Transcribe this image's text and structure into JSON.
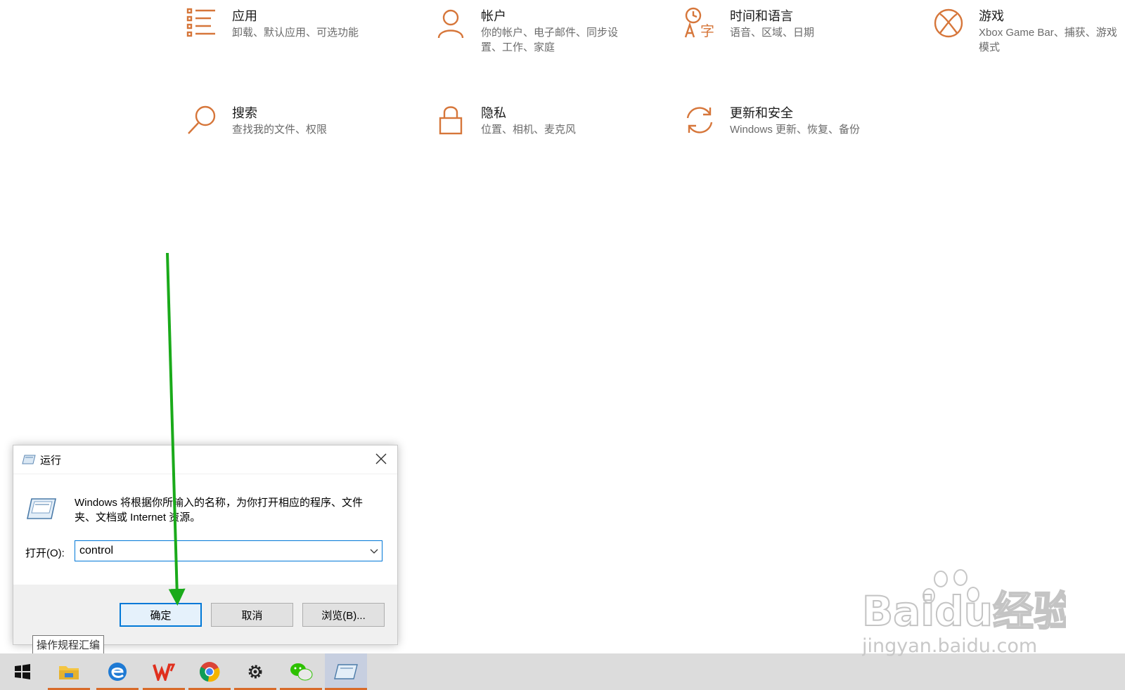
{
  "settings_tiles": [
    {
      "icon": "apps-list-icon",
      "title": "应用",
      "desc": "卸载、默认应用、可选功能"
    },
    {
      "icon": "account-person-icon",
      "title": "帐户",
      "desc": "你的帐户、电子邮件、同步设置、工作、家庭"
    },
    {
      "icon": "time-language-icon",
      "title": "时间和语言",
      "desc": "语音、区域、日期"
    },
    {
      "icon": "xbox-icon",
      "title": "游戏",
      "desc": "Xbox Game Bar、捕获、游戏模式"
    },
    {
      "icon": "search-magnifier-icon",
      "title": "搜索",
      "desc": "查找我的文件、权限"
    },
    {
      "icon": "privacy-lock-icon",
      "title": "隐私",
      "desc": "位置、相机、麦克风"
    },
    {
      "icon": "update-refresh-icon",
      "title": "更新和安全",
      "desc": "Windows 更新、恢复、备份"
    }
  ],
  "run_dialog": {
    "title": "运行",
    "message": "Windows 将根据你所输入的名称，为你打开相应的程序、文件夹、文档或 Internet 资源。",
    "open_label": "打开(O):",
    "open_value": "control",
    "buttons": {
      "ok": "确定",
      "cancel": "取消",
      "browse": "浏览(B)..."
    }
  },
  "tooltip": "操作规程汇编",
  "taskbar": {
    "items": [
      {
        "name": "start-windows-icon"
      },
      {
        "name": "file-explorer-icon"
      },
      {
        "name": "edge-browser-icon"
      },
      {
        "name": "wps-office-icon"
      },
      {
        "name": "chrome-icon"
      },
      {
        "name": "settings-gear-icon"
      },
      {
        "name": "wechat-icon"
      },
      {
        "name": "run-app-icon"
      }
    ]
  },
  "watermark": {
    "brand": "Baidu经验",
    "url": "jingyan.baidu.com"
  },
  "colors": {
    "accent": "#d6763a",
    "arrow": "#1aaa1a",
    "taskbar": "#dcdcdc"
  }
}
